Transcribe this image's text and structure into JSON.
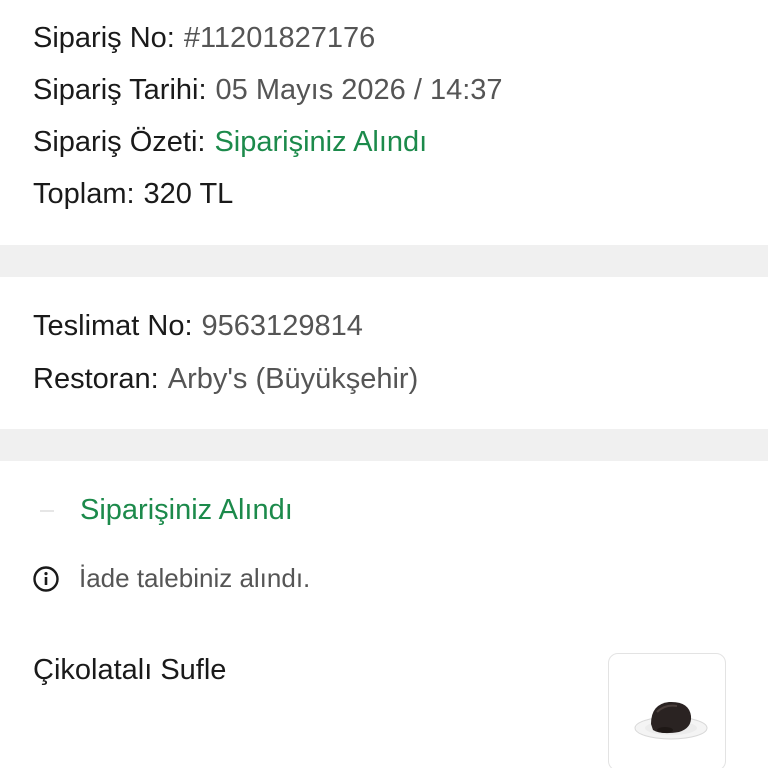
{
  "order": {
    "no_label": "Sipariş No:",
    "no_value": "#11201827176",
    "date_label": "Sipariş Tarihi:",
    "date_value": "05 Mayıs 2026 / 14:37",
    "summary_label": "Sipariş Özeti:",
    "summary_value": "Siparişiniz Alındı",
    "total_label": "Toplam:",
    "total_value": "320 TL"
  },
  "delivery": {
    "no_label": "Teslimat No:",
    "no_value": "9563129814",
    "restaurant_label": "Restoran:",
    "restaurant_value": "Arby's (Büyükşehir)"
  },
  "status": {
    "title": "Siparişiniz Alındı",
    "info_icon": "info-circle-icon",
    "info_text": "İade talebiniz alındı."
  },
  "product": {
    "name": "Çikolatalı Sufle",
    "image_icon": "souffle-dessert-image"
  },
  "colors": {
    "accent_green": "#1c8a4b",
    "divider": "#f0f0f0",
    "text_primary": "#1a1a1a",
    "text_secondary": "#555555"
  }
}
